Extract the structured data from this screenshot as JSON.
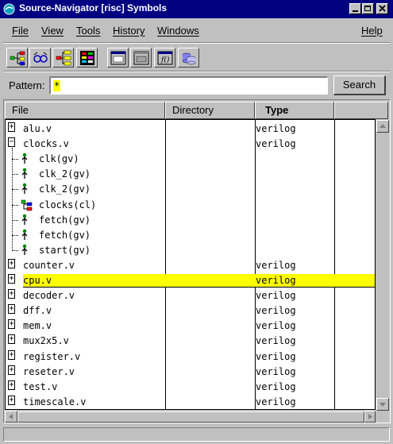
{
  "window": {
    "title": "Source-Navigator [risc] Symbols"
  },
  "menu": [
    "File",
    "View",
    "Tools",
    "History",
    "Windows",
    "Help"
  ],
  "toolbar_icons": [
    "hierarchy-icon",
    "cross-reference-icon",
    "include-icon",
    "class-browser-icon",
    "editor-icon",
    "retriever-icon",
    "grep-icon",
    "project-icon"
  ],
  "pattern": {
    "label": "Pattern:",
    "value": "*"
  },
  "search_label": "Search",
  "columns": [
    "File",
    "Directory",
    "Type"
  ],
  "rows": [
    {
      "name": "alu.v",
      "type": "verilog",
      "level": 0,
      "kind": "file",
      "expanded": false
    },
    {
      "name": "clocks.v",
      "type": "verilog",
      "level": 0,
      "kind": "file",
      "expanded": true
    },
    {
      "name": "clk(gv)",
      "type": "",
      "level": 1,
      "kind": "symbol"
    },
    {
      "name": "clk_2(gv)",
      "type": "",
      "level": 1,
      "kind": "symbol"
    },
    {
      "name": "clk_2(gv)",
      "type": "",
      "level": 1,
      "kind": "symbol"
    },
    {
      "name": "clocks(cl)",
      "type": "",
      "level": 1,
      "kind": "class"
    },
    {
      "name": "fetch(gv)",
      "type": "",
      "level": 1,
      "kind": "symbol"
    },
    {
      "name": "fetch(gv)",
      "type": "",
      "level": 1,
      "kind": "symbol"
    },
    {
      "name": "start(gv)",
      "type": "",
      "level": 1,
      "kind": "symbol"
    },
    {
      "name": "counter.v",
      "type": "verilog",
      "level": 0,
      "kind": "file",
      "expanded": false
    },
    {
      "name": "cpu.v",
      "type": "verilog",
      "level": 0,
      "kind": "file",
      "expanded": false,
      "selected": true
    },
    {
      "name": "decoder.v",
      "type": "verilog",
      "level": 0,
      "kind": "file",
      "expanded": false
    },
    {
      "name": "dff.v",
      "type": "verilog",
      "level": 0,
      "kind": "file",
      "expanded": false
    },
    {
      "name": "mem.v",
      "type": "verilog",
      "level": 0,
      "kind": "file",
      "expanded": false
    },
    {
      "name": "mux2x5.v",
      "type": "verilog",
      "level": 0,
      "kind": "file",
      "expanded": false
    },
    {
      "name": "register.v",
      "type": "verilog",
      "level": 0,
      "kind": "file",
      "expanded": false
    },
    {
      "name": "reseter.v",
      "type": "verilog",
      "level": 0,
      "kind": "file",
      "expanded": false
    },
    {
      "name": "test.v",
      "type": "verilog",
      "level": 0,
      "kind": "file",
      "expanded": false
    },
    {
      "name": "timescale.v",
      "type": "verilog",
      "level": 0,
      "kind": "file",
      "expanded": false
    }
  ],
  "colors": {
    "titlebar": "#000080",
    "highlight": "#ffff00",
    "chrome": "#c0c0c0"
  }
}
